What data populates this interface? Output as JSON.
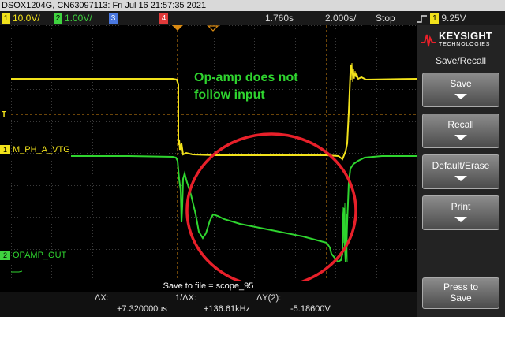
{
  "window": {
    "title": "DSOX1204G, CN63097113: Fri Jul 16 21:57:35 2021"
  },
  "status_bar": {
    "ch1": {
      "num": "1",
      "scale": "10.0V/",
      "color": "#f2e21b"
    },
    "ch2": {
      "num": "2",
      "scale": "1.00V/",
      "color": "#3fd23f"
    },
    "ch3": {
      "num": "3",
      "color": "#4a78e0"
    },
    "ch4": {
      "num": "4",
      "color": "#e03a3a"
    },
    "delay": "1.760s",
    "timebase": "2.000s/",
    "run_state": "Stop",
    "trigger_channel": "1",
    "trigger_level": "9.25V"
  },
  "traces": {
    "ch1_label": "M_PH_A_VTG",
    "ch2_label": "OPAMP_OUT",
    "ch1_color": "#f2e21b",
    "ch2_color": "#3fd23f",
    "trigger_marker": "T"
  },
  "annotation": {
    "line1": "Op-amp does not",
    "line2": "follow input",
    "text_color": "#2fd52f",
    "ellipse_color": "#e8202a"
  },
  "softkey_menu": {
    "brand": "KEYSIGHT",
    "brand_sub": "TECHNOLOGIES",
    "title": "Save/Recall",
    "buttons": [
      "Save",
      "Recall",
      "Default/Erase",
      "Print"
    ],
    "press_to_save": [
      "Press to",
      "Save"
    ]
  },
  "readout": {
    "save_message": "Save to file = scope_95",
    "dx_label": "ΔX:",
    "dx_value": "+7.320000us",
    "inv_dx_label": "1/ΔX:",
    "inv_dx_value": "+136.61kHz",
    "dy_label": "ΔY(2):",
    "dy_value": "-5.18600V"
  }
}
